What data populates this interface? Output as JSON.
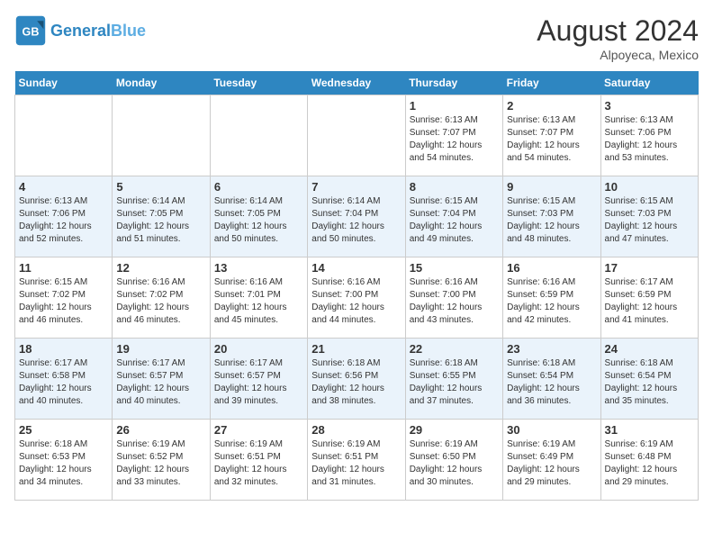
{
  "header": {
    "logo_text_general": "General",
    "logo_text_blue": "Blue",
    "month_year": "August 2024",
    "location": "Alpoyeca, Mexico"
  },
  "weekdays": [
    "Sunday",
    "Monday",
    "Tuesday",
    "Wednesday",
    "Thursday",
    "Friday",
    "Saturday"
  ],
  "weeks": [
    [
      {
        "day": "",
        "info": ""
      },
      {
        "day": "",
        "info": ""
      },
      {
        "day": "",
        "info": ""
      },
      {
        "day": "",
        "info": ""
      },
      {
        "day": "1",
        "info": "Sunrise: 6:13 AM\nSunset: 7:07 PM\nDaylight: 12 hours\nand 54 minutes."
      },
      {
        "day": "2",
        "info": "Sunrise: 6:13 AM\nSunset: 7:07 PM\nDaylight: 12 hours\nand 54 minutes."
      },
      {
        "day": "3",
        "info": "Sunrise: 6:13 AM\nSunset: 7:06 PM\nDaylight: 12 hours\nand 53 minutes."
      }
    ],
    [
      {
        "day": "4",
        "info": "Sunrise: 6:13 AM\nSunset: 7:06 PM\nDaylight: 12 hours\nand 52 minutes."
      },
      {
        "day": "5",
        "info": "Sunrise: 6:14 AM\nSunset: 7:05 PM\nDaylight: 12 hours\nand 51 minutes."
      },
      {
        "day": "6",
        "info": "Sunrise: 6:14 AM\nSunset: 7:05 PM\nDaylight: 12 hours\nand 50 minutes."
      },
      {
        "day": "7",
        "info": "Sunrise: 6:14 AM\nSunset: 7:04 PM\nDaylight: 12 hours\nand 50 minutes."
      },
      {
        "day": "8",
        "info": "Sunrise: 6:15 AM\nSunset: 7:04 PM\nDaylight: 12 hours\nand 49 minutes."
      },
      {
        "day": "9",
        "info": "Sunrise: 6:15 AM\nSunset: 7:03 PM\nDaylight: 12 hours\nand 48 minutes."
      },
      {
        "day": "10",
        "info": "Sunrise: 6:15 AM\nSunset: 7:03 PM\nDaylight: 12 hours\nand 47 minutes."
      }
    ],
    [
      {
        "day": "11",
        "info": "Sunrise: 6:15 AM\nSunset: 7:02 PM\nDaylight: 12 hours\nand 46 minutes."
      },
      {
        "day": "12",
        "info": "Sunrise: 6:16 AM\nSunset: 7:02 PM\nDaylight: 12 hours\nand 46 minutes."
      },
      {
        "day": "13",
        "info": "Sunrise: 6:16 AM\nSunset: 7:01 PM\nDaylight: 12 hours\nand 45 minutes."
      },
      {
        "day": "14",
        "info": "Sunrise: 6:16 AM\nSunset: 7:00 PM\nDaylight: 12 hours\nand 44 minutes."
      },
      {
        "day": "15",
        "info": "Sunrise: 6:16 AM\nSunset: 7:00 PM\nDaylight: 12 hours\nand 43 minutes."
      },
      {
        "day": "16",
        "info": "Sunrise: 6:16 AM\nSunset: 6:59 PM\nDaylight: 12 hours\nand 42 minutes."
      },
      {
        "day": "17",
        "info": "Sunrise: 6:17 AM\nSunset: 6:59 PM\nDaylight: 12 hours\nand 41 minutes."
      }
    ],
    [
      {
        "day": "18",
        "info": "Sunrise: 6:17 AM\nSunset: 6:58 PM\nDaylight: 12 hours\nand 40 minutes."
      },
      {
        "day": "19",
        "info": "Sunrise: 6:17 AM\nSunset: 6:57 PM\nDaylight: 12 hours\nand 40 minutes."
      },
      {
        "day": "20",
        "info": "Sunrise: 6:17 AM\nSunset: 6:57 PM\nDaylight: 12 hours\nand 39 minutes."
      },
      {
        "day": "21",
        "info": "Sunrise: 6:18 AM\nSunset: 6:56 PM\nDaylight: 12 hours\nand 38 minutes."
      },
      {
        "day": "22",
        "info": "Sunrise: 6:18 AM\nSunset: 6:55 PM\nDaylight: 12 hours\nand 37 minutes."
      },
      {
        "day": "23",
        "info": "Sunrise: 6:18 AM\nSunset: 6:54 PM\nDaylight: 12 hours\nand 36 minutes."
      },
      {
        "day": "24",
        "info": "Sunrise: 6:18 AM\nSunset: 6:54 PM\nDaylight: 12 hours\nand 35 minutes."
      }
    ],
    [
      {
        "day": "25",
        "info": "Sunrise: 6:18 AM\nSunset: 6:53 PM\nDaylight: 12 hours\nand 34 minutes."
      },
      {
        "day": "26",
        "info": "Sunrise: 6:19 AM\nSunset: 6:52 PM\nDaylight: 12 hours\nand 33 minutes."
      },
      {
        "day": "27",
        "info": "Sunrise: 6:19 AM\nSunset: 6:51 PM\nDaylight: 12 hours\nand 32 minutes."
      },
      {
        "day": "28",
        "info": "Sunrise: 6:19 AM\nSunset: 6:51 PM\nDaylight: 12 hours\nand 31 minutes."
      },
      {
        "day": "29",
        "info": "Sunrise: 6:19 AM\nSunset: 6:50 PM\nDaylight: 12 hours\nand 30 minutes."
      },
      {
        "day": "30",
        "info": "Sunrise: 6:19 AM\nSunset: 6:49 PM\nDaylight: 12 hours\nand 29 minutes."
      },
      {
        "day": "31",
        "info": "Sunrise: 6:19 AM\nSunset: 6:48 PM\nDaylight: 12 hours\nand 29 minutes."
      }
    ]
  ]
}
